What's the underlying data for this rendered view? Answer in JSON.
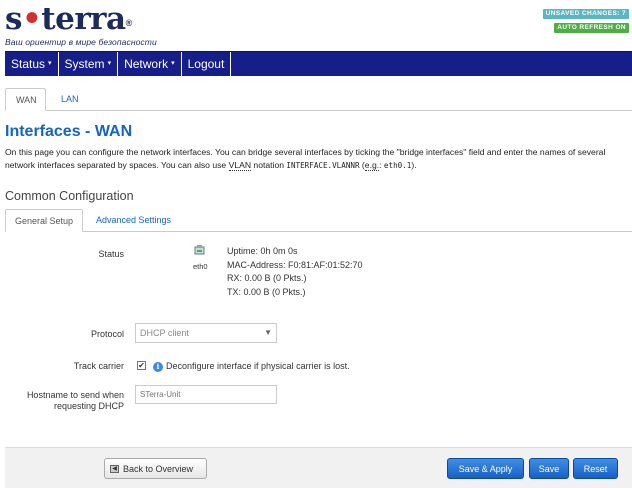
{
  "header": {
    "logo_prefix": "s",
    "logo_dot": "•",
    "logo_suffix": "terra",
    "logo_reg": "®",
    "tagline": "Ваш ориентир в мире безопасности",
    "badge_unsaved": "UNSAVED CHANGES: 7",
    "badge_refresh": "AUTO REFRESH ON"
  },
  "menu": {
    "items": [
      {
        "label": "Status",
        "caret": "▾"
      },
      {
        "label": "System",
        "caret": "▾"
      },
      {
        "label": "Network",
        "caret": "▾"
      },
      {
        "label": "Logout",
        "caret": ""
      }
    ]
  },
  "tabs_top": [
    "WAN",
    "LAN"
  ],
  "page": {
    "title": "Interfaces - WAN",
    "desc_part1": "On this page you can configure the network interfaces. You can bridge several interfaces by ticking the \"bridge interfaces\" field and enter the names of several network interfaces separated by spaces. You can also use ",
    "desc_vlan": "VLAN",
    "desc_part2": " notation ",
    "desc_code1": "INTERFACE.VLANNR",
    "desc_part3": " (",
    "desc_eg": "e.g.",
    "desc_part4": ": ",
    "desc_code2": "eth0.1",
    "desc_part5": ")."
  },
  "section": {
    "title": "Common Configuration",
    "tabs": [
      "General Setup",
      "Advanced Settings"
    ]
  },
  "status": {
    "label": "Status",
    "iface": "eth0",
    "uptime": "Uptime: 0h 0m 0s",
    "mac": "MAC-Address: F0:81:AF:01:52:70",
    "rx": "RX: 0.00 B (0 Pkts.)",
    "tx": "TX: 0.00 B (0 Pkts.)"
  },
  "protocol": {
    "label": "Protocol",
    "value": "DHCP client"
  },
  "track_carrier": {
    "label": "Track carrier",
    "checked": true,
    "hint": "Deconfigure interface if physical carrier is lost."
  },
  "hostname": {
    "label_line1": "Hostname to send when",
    "label_line2": "requesting DHCP",
    "placeholder": "STerra-Unit"
  },
  "footer": {
    "back": "Back to Overview",
    "save_apply": "Save & Apply",
    "save": "Save",
    "reset": "Reset"
  },
  "colors": {
    "menu_bg": "#161e8a",
    "link": "#1565c0",
    "button_blue": "#2a74d6",
    "badge_unsaved": "#5bb6c4",
    "badge_refresh": "#4fae43"
  }
}
